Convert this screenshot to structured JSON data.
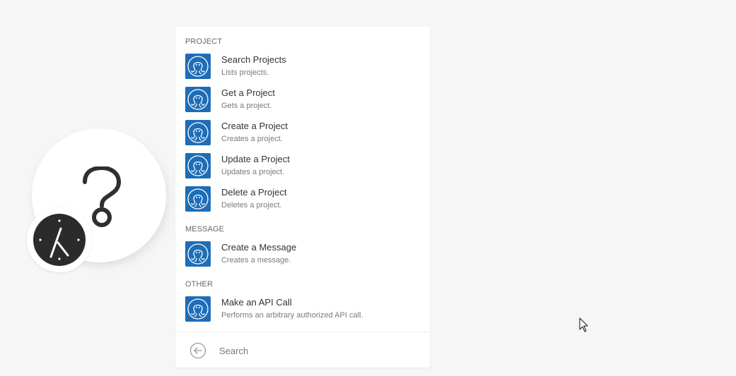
{
  "sections": [
    {
      "header": "PROJECT",
      "items": [
        {
          "title": "Search Projects",
          "description": "Lists projects."
        },
        {
          "title": "Get a Project",
          "description": "Gets a project."
        },
        {
          "title": "Create a Project",
          "description": "Creates a project."
        },
        {
          "title": "Update a Project",
          "description": "Updates a project."
        },
        {
          "title": "Delete a Project",
          "description": "Deletes a project."
        }
      ]
    },
    {
      "header": "MESSAGE",
      "items": [
        {
          "title": "Create a Message",
          "description": "Creates a message."
        }
      ]
    },
    {
      "header": "OTHER",
      "items": [
        {
          "title": "Make an API Call",
          "description": "Performs an arbitrary authorized API call."
        }
      ]
    }
  ],
  "search": {
    "placeholder": "Search"
  },
  "colors": {
    "app_icon": "#1e6db7",
    "background": "#f6f6f6",
    "clock_badge": "#2b2b2b"
  },
  "icons": {
    "app_icon": "octopus-icon",
    "module_placeholder": "question-mark-icon",
    "module_badge": "clock-icon",
    "back": "back-arrow-icon",
    "cursor": "mouse-cursor-icon"
  }
}
